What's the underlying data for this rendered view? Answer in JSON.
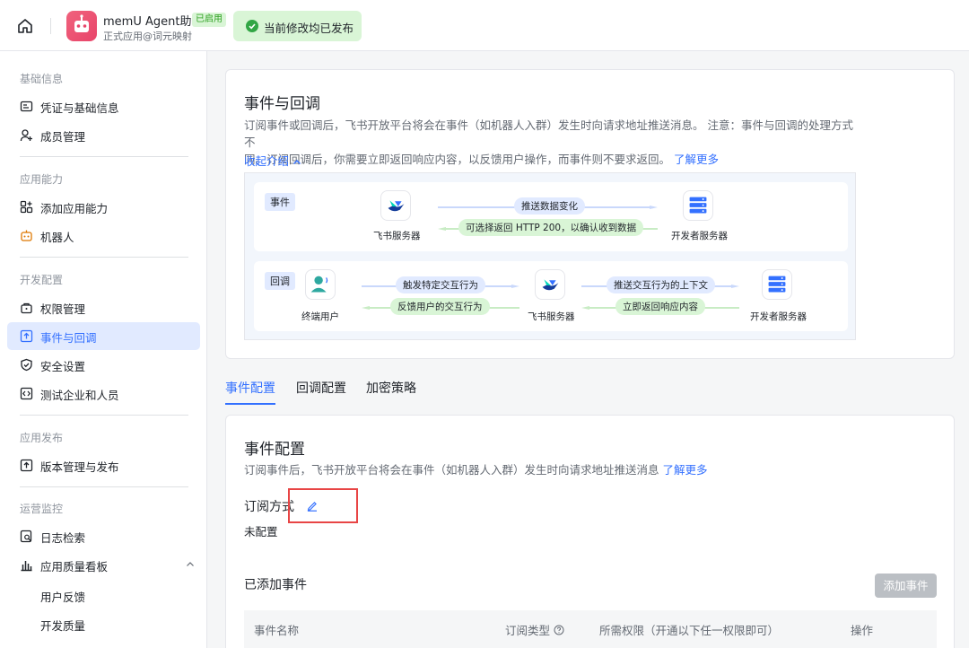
{
  "header": {
    "app_name": "memU Agent助手",
    "app_status": "已启用",
    "app_sub": "正式应用@词元映射",
    "toast": "当前修改均已发布"
  },
  "sidebar": {
    "groups": [
      {
        "title": "基础信息",
        "items": [
          "凭证与基础信息",
          "成员管理"
        ]
      },
      {
        "title": "应用能力",
        "items": [
          "添加应用能力",
          "机器人"
        ]
      },
      {
        "title": "开发配置",
        "items": [
          "权限管理",
          "事件与回调",
          "安全设置",
          "测试企业和人员"
        ]
      },
      {
        "title": "应用发布",
        "items": [
          "版本管理与发布"
        ]
      },
      {
        "title": "运营监控",
        "items": [
          "日志检索",
          "应用质量看板"
        ]
      }
    ],
    "subitems": [
      "用户反馈",
      "开发质量"
    ],
    "active": "事件与回调"
  },
  "intro": {
    "title": "事件与回调",
    "desc_1": "订阅事件或回调后，飞书开放平台将会在事件（如机器人入群）发生时向请求地址推送消息。 注意：事件与回调的处理方式不",
    "desc_2": "同。订阅回调后，你需要立即返回响应内容，以反馈用户操作，而事件则不要求返回。",
    "learn_more": "了解更多",
    "collapse": "收起介绍"
  },
  "diagram": {
    "event_tag": "事件",
    "callback_tag": "回调",
    "feishu_server": "飞书服务器",
    "dev_server": "开发者服务器",
    "end_user": "终端用户",
    "push_change": "推送数据变化",
    "optional_return": "可选择返回 HTTP 200，以确认收到数据",
    "trigger_action": "触发特定交互行为",
    "feedback_action": "反馈用户的交互行为",
    "push_context": "推送交互行为的上下文",
    "return_now": "立即返回响应内容"
  },
  "tabs": [
    "事件配置",
    "回调配置",
    "加密策略"
  ],
  "event_config": {
    "title": "事件配置",
    "desc": "订阅事件后，飞书开放平台将会在事件（如机器人入群）发生时向请求地址推送消息",
    "learn_more": "了解更多",
    "sub_method_label": "订阅方式",
    "sub_method_value": "未配置",
    "added_events": "已添加事件",
    "add_button": "添加事件",
    "columns": [
      "事件名称",
      "订阅类型",
      "所需权限（开通以下任一权限即可）",
      "操作"
    ]
  }
}
